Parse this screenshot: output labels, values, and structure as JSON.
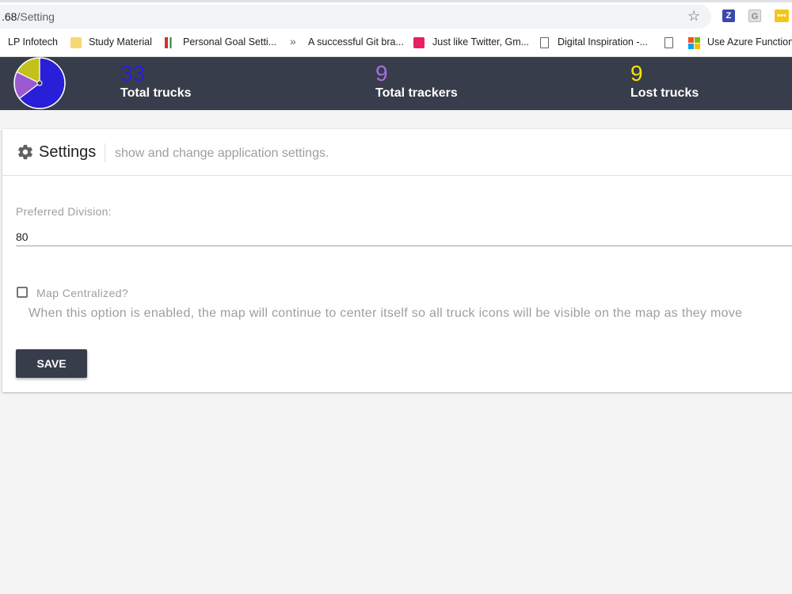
{
  "browser": {
    "url_main": ".68",
    "url_path": "/Setting",
    "extensions": [
      "Z",
      "G",
      "•••"
    ],
    "bookmarks": [
      {
        "label": "LP Infotech",
        "icon": "none"
      },
      {
        "label": "Study Material",
        "icon": "folder-icon"
      },
      {
        "label": "Personal Goal Setti...",
        "icon": "chart-favicon"
      },
      {
        "label": "A successful Git bra...",
        "icon": "chevron-favicon"
      },
      {
        "label": "Just like Twitter, Gm...",
        "icon": "red-favicon"
      },
      {
        "label": "Digital Inspiration -...",
        "icon": "document-icon"
      },
      {
        "label": "",
        "icon": "document-icon"
      },
      {
        "label": "Use Azure Function...",
        "icon": "microsoft-icon"
      }
    ]
  },
  "stats": {
    "pie": {
      "slices": [
        {
          "label": "Total trucks",
          "value": 33,
          "color": "#2a1fd8"
        },
        {
          "label": "Total trackers",
          "value": 9,
          "color": "#9b59d0"
        },
        {
          "label": "Lost trucks",
          "value": 9,
          "color": "#c4c21a"
        }
      ]
    },
    "items": [
      {
        "value": "33",
        "label": "Total trucks",
        "color": "#2a1fd8"
      },
      {
        "value": "9",
        "label": "Total trackers",
        "color": "#a86ee0"
      },
      {
        "value": "9",
        "label": "Lost trucks",
        "color": "#f5e400"
      }
    ]
  },
  "settings": {
    "title": "Settings",
    "subtitle": "show and change application settings.",
    "division_label": "Preferred Division:",
    "division_value": "80",
    "map_centralized_label": "Map Centralized?",
    "map_centralized_checked": false,
    "map_centralized_help": "When this option is enabled, the map will continue to center itself so all truck icons will be visible on the map as they move",
    "save_label": "SAVE"
  }
}
